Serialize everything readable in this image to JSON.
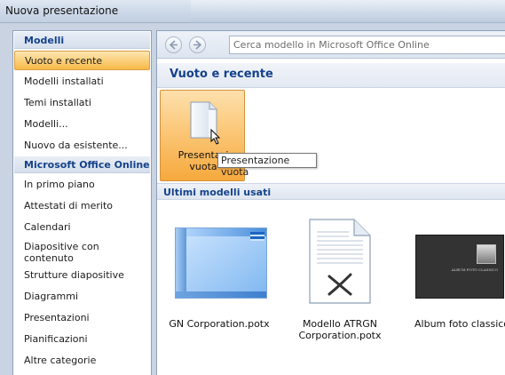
{
  "window": {
    "title": "Nuova presentazione"
  },
  "sidebar": {
    "sections": [
      {
        "header": "Modelli",
        "items": [
          {
            "label": "Vuoto e recente",
            "selected": true
          },
          {
            "label": "Modelli installati"
          },
          {
            "label": "Temi installati"
          },
          {
            "label": "Modelli..."
          },
          {
            "label": "Nuovo da esistente..."
          }
        ]
      },
      {
        "header": "Microsoft Office Online",
        "items": [
          {
            "label": "In primo piano"
          },
          {
            "label": "Attestati di merito"
          },
          {
            "label": "Calendari"
          },
          {
            "label": "Diapositive con contenuto"
          },
          {
            "label": "Strutture diapositive"
          },
          {
            "label": "Diagrammi"
          },
          {
            "label": "Presentazioni"
          },
          {
            "label": "Pianificazioni"
          },
          {
            "label": "Altre categorie"
          }
        ]
      }
    ]
  },
  "toolbar": {
    "back_icon": "arrow-left-icon",
    "forward_icon": "arrow-right-icon",
    "search_placeholder": "Cerca modello in Microsoft Office Online"
  },
  "main": {
    "title": "Vuoto e recente",
    "blank": {
      "label": "Presentazione vuota",
      "visible_label_line1": "Presentazi",
      "visible_label_line2": "vuota",
      "icon": "blank-document-icon"
    },
    "tooltip": "Presentazione vuota",
    "recent_header": "Ultimi modelli usati",
    "recent": [
      {
        "name_line1": "GN Corporation.potx",
        "name_line2": ""
      },
      {
        "name_line1": "Modello ATRGN",
        "name_line2": "Corporation.potx"
      },
      {
        "name_line1": "Album foto classico",
        "name_line2": ""
      }
    ],
    "album_caption": "ALBUM FOTO CLASSICO"
  },
  "colors": {
    "accent": "#15428b",
    "selection": "#f8b948"
  }
}
